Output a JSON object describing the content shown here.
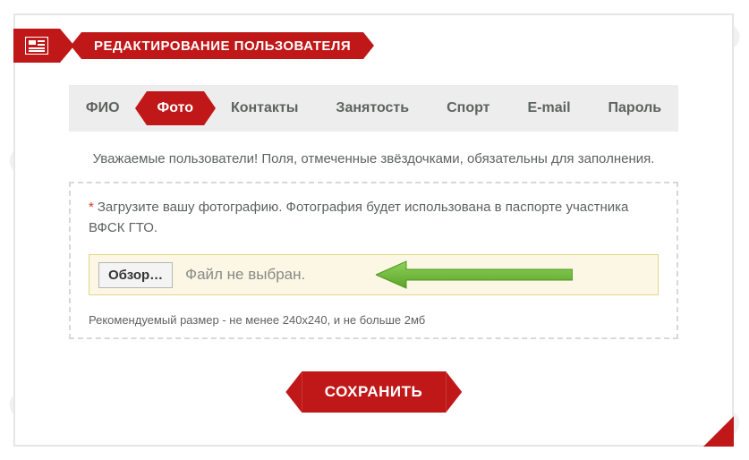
{
  "header": {
    "title": "РЕДАКТИРОВАНИЕ ПОЛЬЗОВАТЕЛЯ"
  },
  "tabs": {
    "items": [
      {
        "label": "ФИО"
      },
      {
        "label": "Фото"
      },
      {
        "label": "Контакты"
      },
      {
        "label": "Занятость"
      },
      {
        "label": "Спорт"
      },
      {
        "label": "E-mail"
      },
      {
        "label": "Пароль"
      }
    ],
    "active_index": 1
  },
  "notice": "Уважаемые пользователи! Поля, отмеченные звёздочками, обязательны для заполнения.",
  "upload": {
    "required_mark": "*",
    "label": "Загрузите вашу фотографию. Фотография будет использована в паспорте участника ВФСК ГТО.",
    "browse_label": "Обзор…",
    "file_status": "Файл не выбран.",
    "recommendation": "Рекомендуемый размер - не менее 240х240, и не больше 2мб"
  },
  "actions": {
    "save": "СОХРАНИТЬ"
  }
}
